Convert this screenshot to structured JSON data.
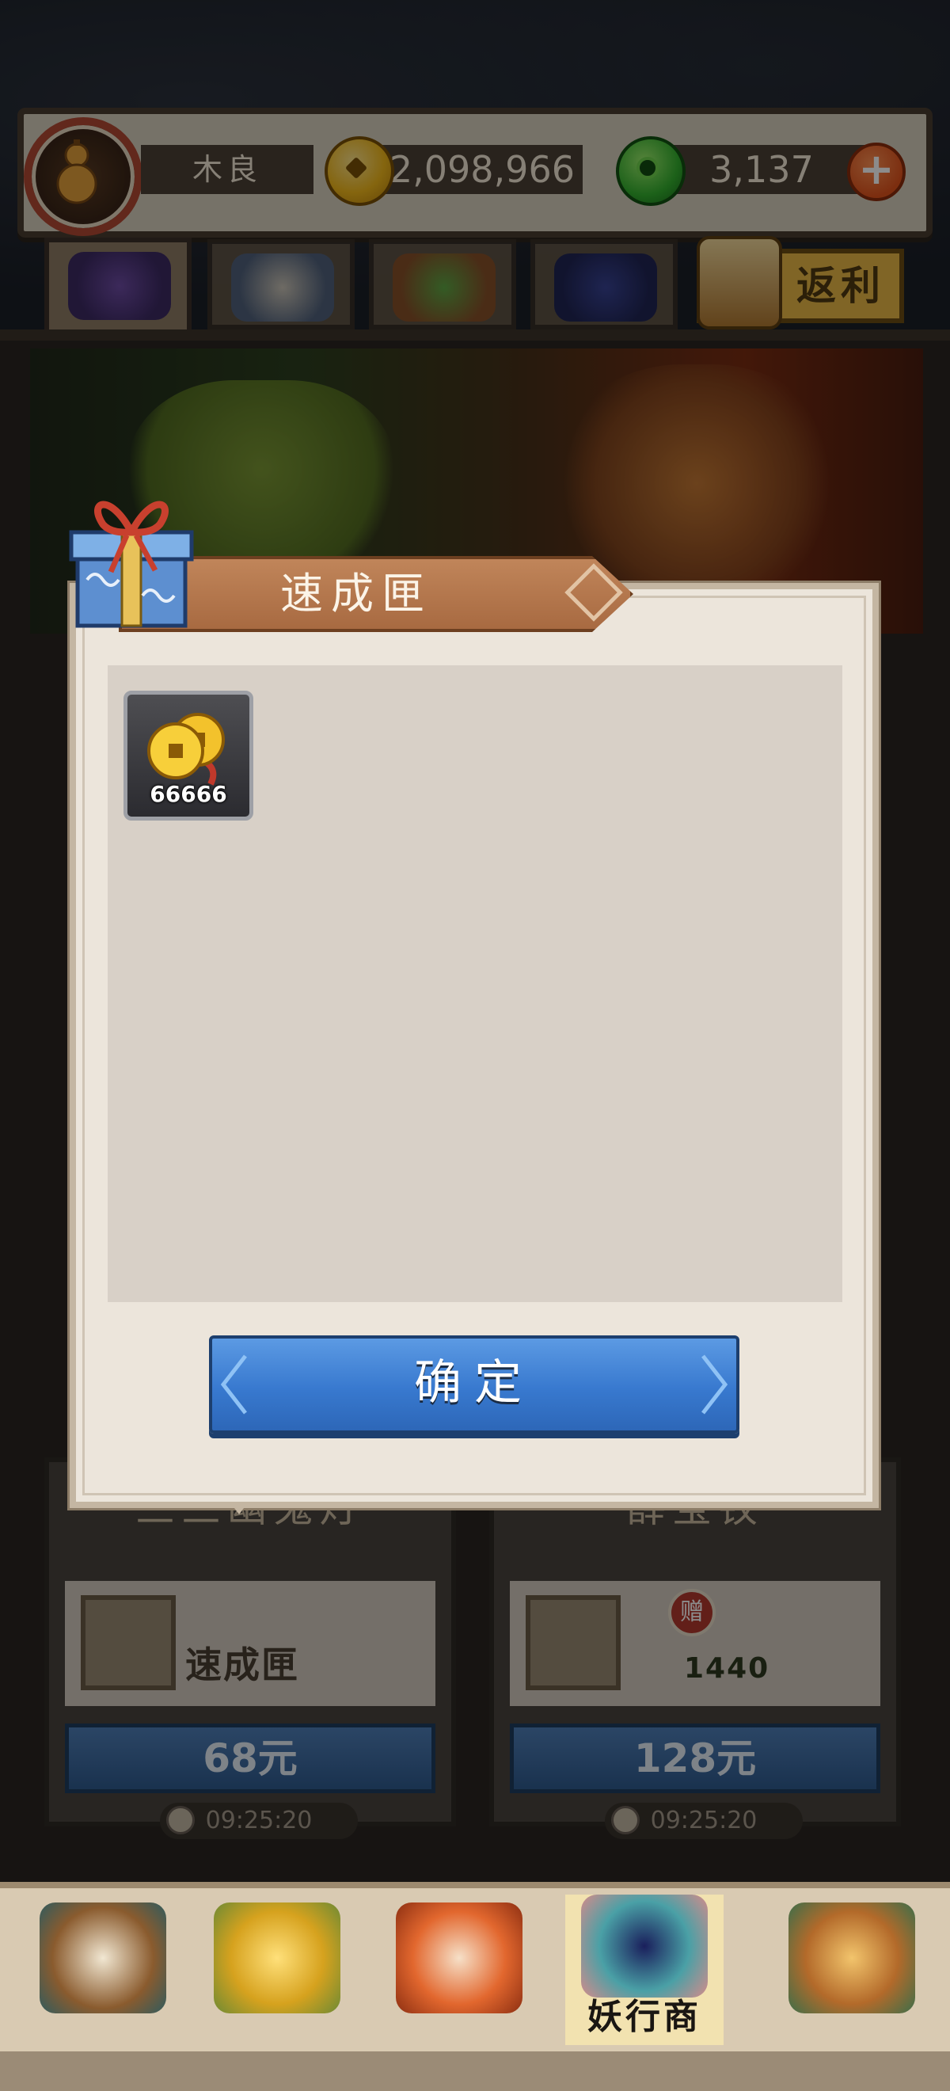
{
  "header": {
    "player_name": "木良",
    "coins": "2,098,966",
    "jade": "3,137",
    "add_button": "+"
  },
  "tabs": [
    {
      "name": "monster"
    },
    {
      "name": "eye"
    },
    {
      "name": "chest"
    },
    {
      "name": "book"
    },
    {
      "name": "rebate",
      "label": "返利"
    }
  ],
  "products": [
    {
      "name": "三三幽鬼灯",
      "item_label": "速成匣",
      "price": "68元",
      "timer": "09:25:20"
    },
    {
      "name": "薛宝钗",
      "item_label": "1440",
      "badge": "赠",
      "price": "128元",
      "timer": "09:25:20"
    }
  ],
  "dialog": {
    "title": "速成匣",
    "reward_quantity": "66666",
    "confirm_label": "确定"
  },
  "bottom_nav": {
    "active_label": "妖行商"
  },
  "colors": {
    "title_bar": "#a86a41",
    "confirm_blue": "#3879cf",
    "dialog_bg": "#ece5db"
  }
}
